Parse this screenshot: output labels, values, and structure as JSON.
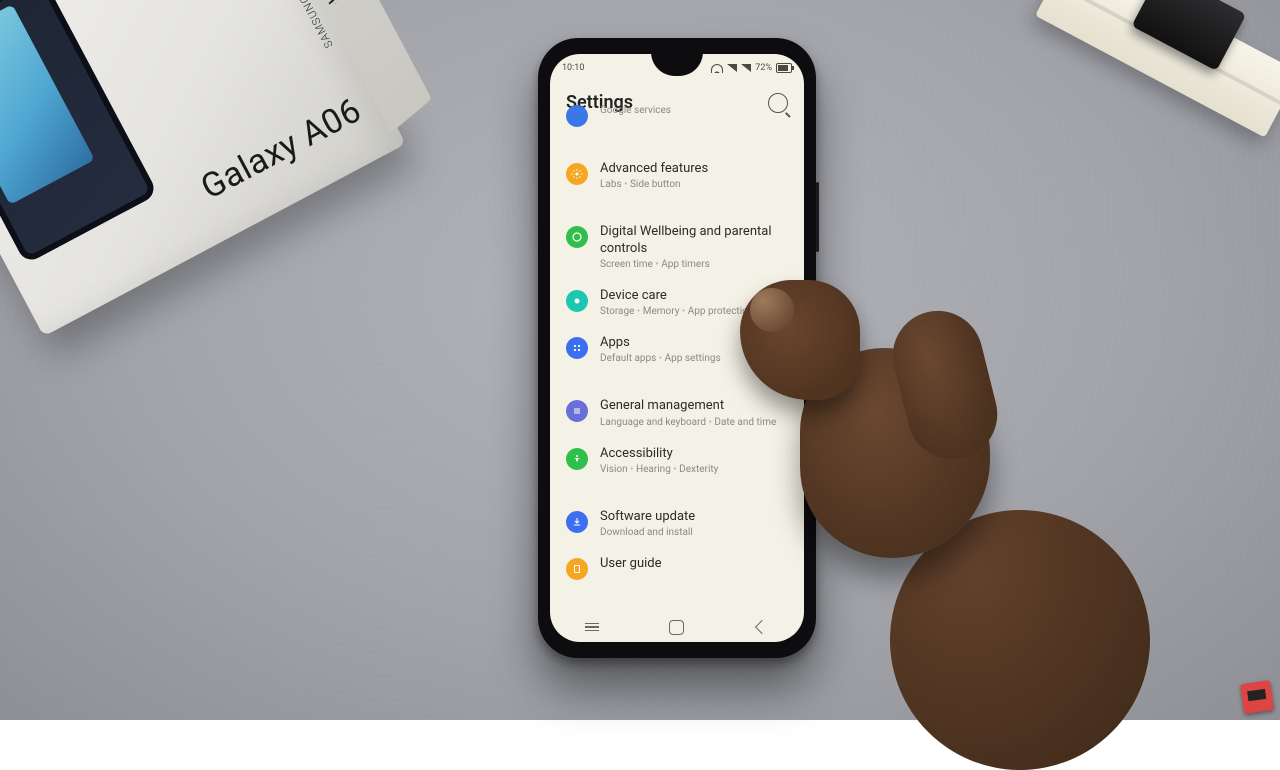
{
  "photo": {
    "box_brand": "SAMSUNG",
    "box_model": "Galaxy A06"
  },
  "statusbar": {
    "time": "10:10",
    "battery": "72%"
  },
  "header": {
    "title": "Settings"
  },
  "items": {
    "google": {
      "title": "",
      "sub1": "Google services"
    },
    "advanced": {
      "title": "Advanced features",
      "sub1": "Labs",
      "sub2": "Side button"
    },
    "wellbeing": {
      "title": "Digital Wellbeing and parental controls",
      "sub1": "Screen time",
      "sub2": "App timers"
    },
    "devicecare": {
      "title": "Device care",
      "sub1": "Storage",
      "sub2": "Memory",
      "sub3": "App protection"
    },
    "apps": {
      "title": "Apps",
      "sub1": "Default apps",
      "sub2": "App settings"
    },
    "general": {
      "title": "General management",
      "sub1": "Language and keyboard",
      "sub2": "Date and time"
    },
    "a11y": {
      "title": "Accessibility",
      "sub1": "Vision",
      "sub2": "Hearing",
      "sub3": "Dexterity"
    },
    "swupdate": {
      "title": "Software update",
      "sub1": "Download and install"
    },
    "userguide": {
      "title": "User guide"
    }
  },
  "colors": {
    "google": "#3b78e7",
    "advanced": "#f5a623",
    "wellbeing": "#2fbf4a",
    "devicecare": "#1bc7b0",
    "apps": "#3c6ff0",
    "general": "#6a6fd8",
    "a11y": "#2fbf4a",
    "swupdate": "#3c6ff0",
    "userguide": "#f5a623"
  }
}
